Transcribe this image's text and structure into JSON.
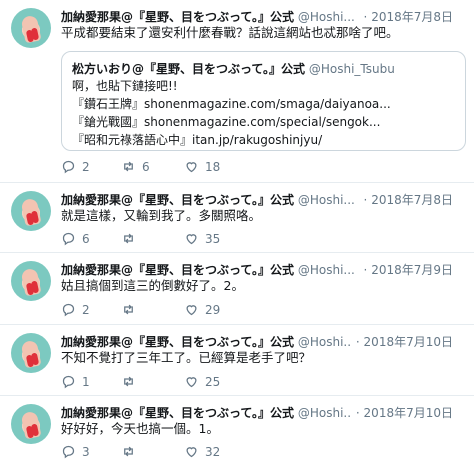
{
  "account": {
    "name": "加納愛那果@『星野、目をつぶって。』公式",
    "handle": "@Hoshi...",
    "dot": "·"
  },
  "tweets": [
    {
      "date": "2018年7月8日",
      "text": "平成都要結束了還安利什麼春戰？話說這網站也忒那啥了吧。",
      "quote": {
        "author": "松方いおり@『星野、目をつぶって。』公式",
        "handle": "@Hoshi_Tsubu",
        "lines": [
          "啊，也貼下鏈接吧!!",
          "『鑽石王牌』shonenmagazine.com/smaga/daiyanoa...",
          "『鎗光戰國』shonenmagazine.com/special/sengok...",
          "『昭和元祿落語心中』itan.jp/rakugoshinjyu/"
        ]
      },
      "replies": "2",
      "retweets": "6",
      "likes": "18"
    },
    {
      "date": "2018年7月8日",
      "text": "就是這樣，又輪到我了。多關照咯。",
      "replies": "6",
      "retweets": "",
      "likes": "35"
    },
    {
      "date": "2018年7月9日",
      "text": "姑且搞個到這三的倒數好了。2。",
      "replies": "2",
      "retweets": "",
      "likes": "29"
    },
    {
      "date": "2018年7月10日",
      "text": "不知不覺打了三年工了。已經算是老手了吧？",
      "replies": "1",
      "retweets": "",
      "likes": "25"
    },
    {
      "date": "2018年7月10日",
      "text": "好好好，今天也搞一個。1。",
      "replies": "3",
      "retweets": "",
      "likes": "32"
    }
  ],
  "colors": {
    "icon": "#657786",
    "border": "#e6ecf0",
    "avatar_bg": "#7cc9c0"
  }
}
